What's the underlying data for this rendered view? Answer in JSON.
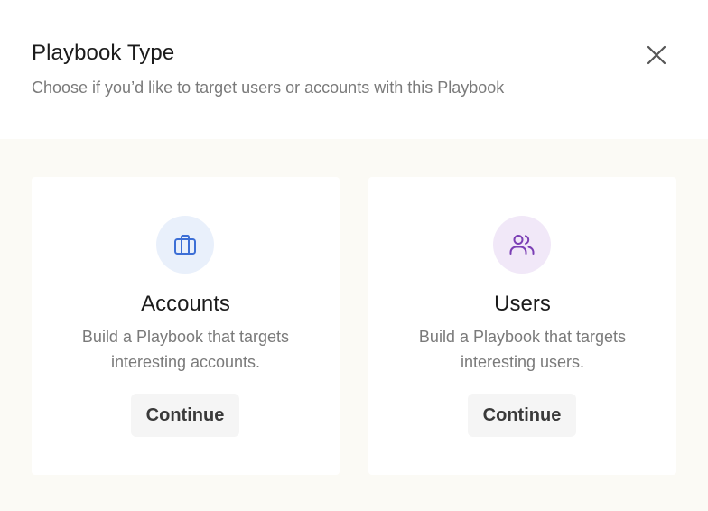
{
  "header": {
    "title": "Playbook Type",
    "subtitle": "Choose if you’d like to target users or accounts with this Playbook"
  },
  "cards": [
    {
      "icon": "briefcase-icon",
      "title": "Accounts",
      "description": "Build a Playbook that targets interesting accounts.",
      "button_label": "Continue",
      "icon_color": "#3d6fd6",
      "icon_bg": "#e9f0fb"
    },
    {
      "icon": "users-icon",
      "title": "Users",
      "description": "Build a Playbook that targets interesting users.",
      "button_label": "Continue",
      "icon_color": "#7b3fb5",
      "icon_bg": "#f1e8f8"
    }
  ],
  "colors": {
    "body_background": "#fbfaf5",
    "button_background": "#f5f5f5"
  }
}
